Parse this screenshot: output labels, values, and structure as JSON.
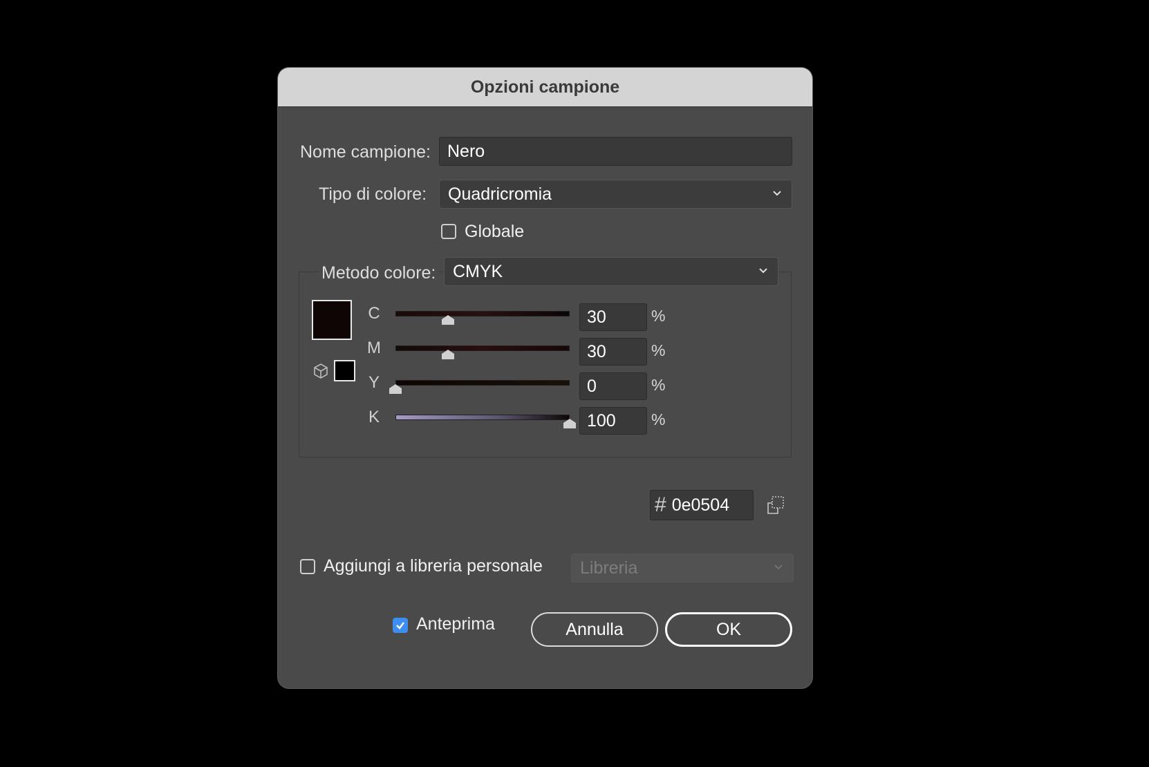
{
  "dialog": {
    "title": "Opzioni campione",
    "swatch_name_label": "Nome campione:",
    "swatch_name_value": "Nero",
    "color_type_label": "Tipo di colore:",
    "color_type_value": "Quadricromia",
    "global_label": "Globale",
    "global_checked": false,
    "color_mode_label": "Metodo colore:",
    "color_mode_value": "CMYK",
    "channels": [
      {
        "label": "C",
        "value": "30",
        "unit": "%",
        "level": 0.3
      },
      {
        "label": "M",
        "value": "30",
        "unit": "%",
        "level": 0.3
      },
      {
        "label": "Y",
        "value": "0",
        "unit": "%",
        "level": 0.0
      },
      {
        "label": "K",
        "value": "100",
        "unit": "%",
        "level": 1.0
      }
    ],
    "hex_symbol": "#",
    "hex_value": "0e0504",
    "add_to_library_label": "Aggiungi a libreria personale",
    "add_to_library_checked": false,
    "library_placeholder": "Libreria",
    "preview_label": "Anteprima",
    "preview_checked": true,
    "cancel_label": "Annulla",
    "ok_label": "OK"
  },
  "colors": {
    "swatch": "#0e0504",
    "out_of_gamut_swatch": "#000000",
    "accent": "#3d8ef0"
  }
}
